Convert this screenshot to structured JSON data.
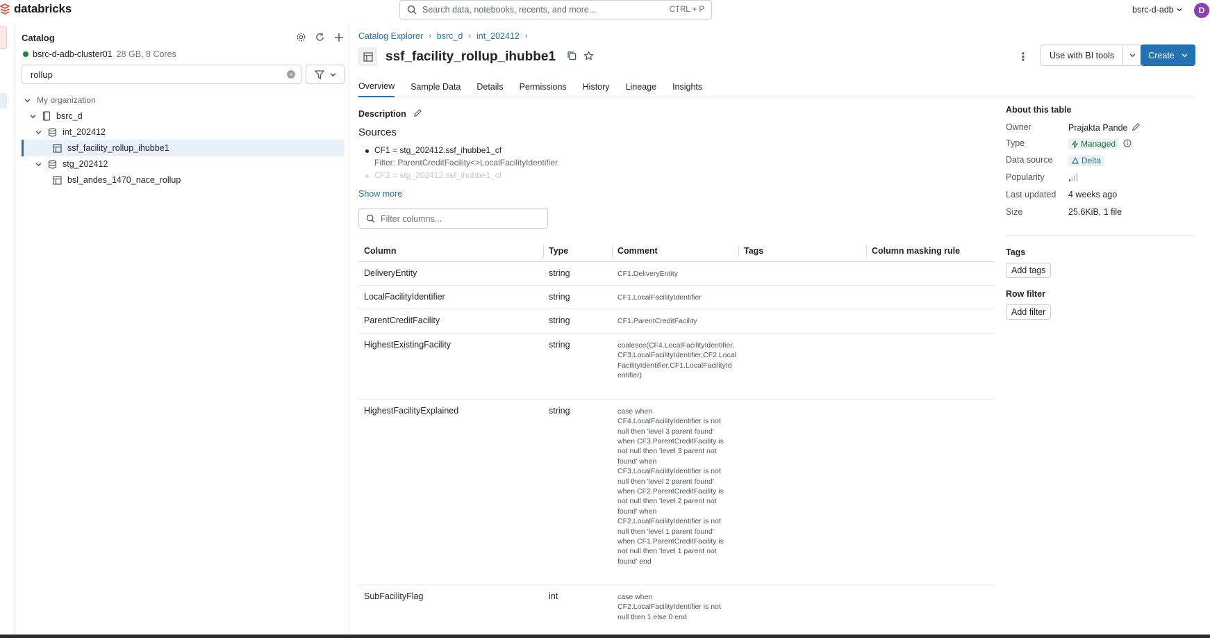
{
  "brand": {
    "name": "databricks"
  },
  "search": {
    "placeholder": "Search data, notebooks, recents, and more...",
    "shortcut": "CTRL + P"
  },
  "user": {
    "workspace": "bsrc-d-adb",
    "avatar_initial": "D"
  },
  "sidebar": {
    "title": "Catalog",
    "cluster": {
      "name": "bsrc-d-adb-cluster01",
      "meta": "28 GB, 8 Cores"
    },
    "filter_value": "rollup",
    "tree": {
      "org": "My organization",
      "catalog": "bsrc_d",
      "schema1": "int_202412",
      "table1": "ssf_facility_rollup_ihubbe1",
      "schema2": "stg_202412",
      "table2": "bsl_andes_1470_nace_rollup"
    }
  },
  "breadcrumb": {
    "root": "Catalog Explorer",
    "catalog": "bsrc_d",
    "schema": "int_202412"
  },
  "table_title": "ssf_facility_rollup_ihubbe1",
  "actions": {
    "bi_tools": "Use with BI tools",
    "create": "Create"
  },
  "tabs": [
    "Overview",
    "Sample Data",
    "Details",
    "Permissions",
    "History",
    "Lineage",
    "Insights"
  ],
  "overview": {
    "description_label": "Description",
    "sources_title": "Sources",
    "source1": "CF1 = stg_202412.ssf_ihubbe1_cf",
    "source1_filter": "Filter: ParentCreditFacility<>LocalFacilityIdentifier",
    "source2": "CF2 = stg_202412.ssf_ihubbe1_cf",
    "show_more": "Show more",
    "filter_placeholder": "Filter columns..."
  },
  "columns_table": {
    "headers": [
      "Column",
      "Type",
      "Comment",
      "Tags",
      "Column masking rule"
    ],
    "rows": [
      {
        "name": "DeliveryEntity",
        "type": "string",
        "comment": "CF1.DeliveryEntity"
      },
      {
        "name": "LocalFacilityIdentifier",
        "type": "string",
        "comment": "CF1.LocalFacilityIdentifier"
      },
      {
        "name": "ParentCreditFacility",
        "type": "string",
        "comment": "CF1.ParentCreditFacility"
      },
      {
        "name": "HighestExistingFacility",
        "type": "string",
        "comment": "coalesce(CF4.LocalFacilityIdentifier,\nCF3.LocalFacilityIdentifier,CF2.Local\nFacilityIdentifier,CF1.LocalFacilityId\nentifier)"
      },
      {
        "name": "HighestFacilityExplained",
        "type": "string",
        "comment": "case when\nCF4.LocalFacilityIdentifier is not\nnull then 'level 3 parent found'\nwhen CF3.ParentCreditFacility is\nnot null then 'level 3 parent not\nfound' when\nCF3.LocalFacilityIdentifier is not\nnull then 'level 2 parent found'\nwhen CF2.ParentCreditFacility is\nnot null then 'level 2 parent not\nfound' when\nCF2.LocalFacilityIdentifier is not\nnull then 'level 1 parent found'\nwhen CF1.ParentCreditFacility is\nnot null then 'level 1 parent not\nfound' end"
      },
      {
        "name": "SubFacilityFlag",
        "type": "int",
        "comment": "case when\nCF2.LocalFacilityIdentifier is not\nnull then 1 else 0 end"
      }
    ]
  },
  "about": {
    "title": "About this table",
    "owner_label": "Owner",
    "owner": "Prajakta Pande",
    "type_label": "Type",
    "type": "Managed",
    "source_label": "Data source",
    "source": "Delta",
    "popularity_label": "Popularity",
    "popularity_level": 0.25,
    "updated_label": "Last updated",
    "updated": "4 weeks ago",
    "size_label": "Size",
    "size": "25.6KiB, 1 file"
  },
  "tags": {
    "title": "Tags",
    "button": "Add tags"
  },
  "row_filter": {
    "title": "Row filter",
    "button": "Add filter"
  },
  "colors": {
    "accent": "#2272b4",
    "cluster_online": "#1a8a3a",
    "avatar": "#8b3fb8",
    "brand": "#e8432e"
  }
}
